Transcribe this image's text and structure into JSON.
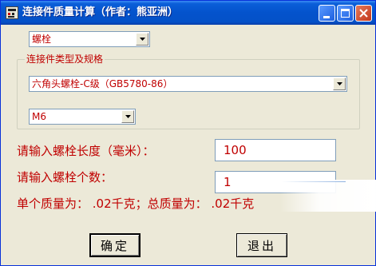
{
  "window": {
    "title": "连接件质量计算（作者：熊亚洲）"
  },
  "type_select": {
    "value": "螺栓"
  },
  "spec_group": {
    "legend": "连接件类型及规格",
    "standard_select": {
      "value": "六角头螺栓-C级（GB5780-86）"
    },
    "size_select": {
      "value": "M6"
    }
  },
  "form": {
    "length_label": "请输入螺栓长度（毫米）：",
    "length_value": "100",
    "count_label": "请输入螺栓个数：",
    "count_value": "1",
    "result_text": "单个质量为： .02千克；总质量为： .02千克"
  },
  "buttons": {
    "ok": "确定",
    "exit": "退出"
  },
  "colors": {
    "accent_text": "#c00000",
    "title_bar": "#0453cc",
    "window_bg": "#ece9d8"
  },
  "icons": [
    "app-icon",
    "minimize-icon",
    "maximize-icon",
    "close-icon",
    "chevron-down-icon"
  ]
}
